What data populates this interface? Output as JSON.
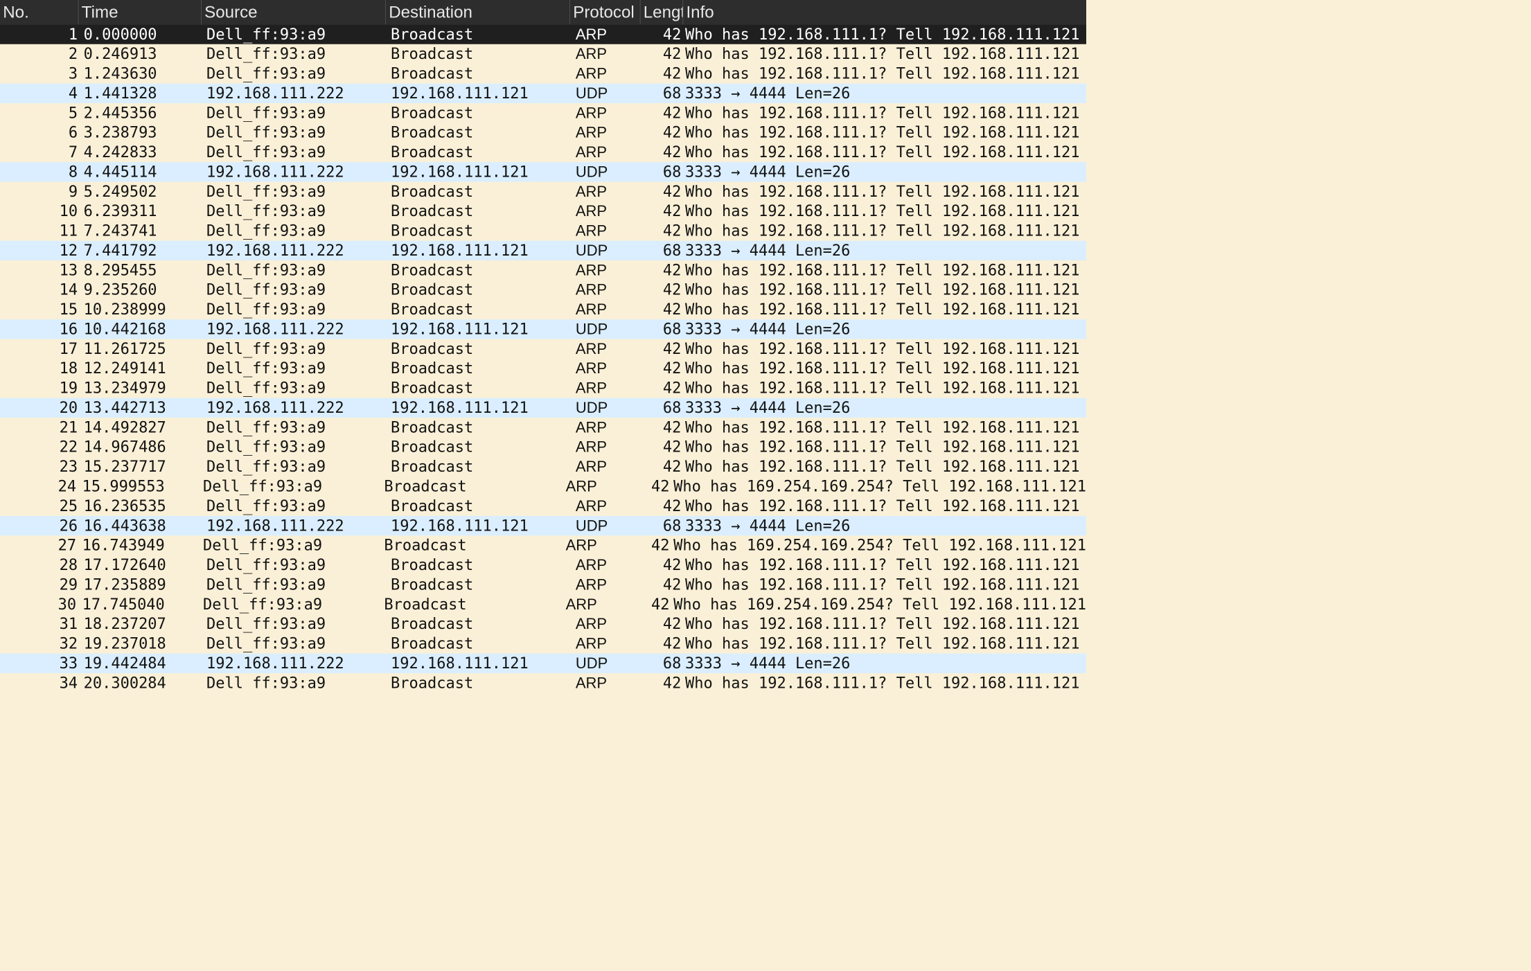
{
  "columns": {
    "no": "No.",
    "time": "Time",
    "source": "Source",
    "destination": "Destination",
    "protocol": "Protocol",
    "length": "Lengt",
    "info": "Info"
  },
  "colors": {
    "arp_row": "#faf0d7",
    "udp_row": "#daeeff",
    "selected_row": "#1f1f1f",
    "header_bg": "#2d2d2d"
  },
  "selected_packet": "1",
  "packets": [
    {
      "no": "1",
      "time": "0.000000",
      "source": "Dell_ff:93:a9",
      "destination": "Broadcast",
      "protocol": "ARP",
      "length": "42",
      "info": "Who has 192.168.111.1? Tell 192.168.111.121"
    },
    {
      "no": "2",
      "time": "0.246913",
      "source": "Dell_ff:93:a9",
      "destination": "Broadcast",
      "protocol": "ARP",
      "length": "42",
      "info": "Who has 192.168.111.1? Tell 192.168.111.121"
    },
    {
      "no": "3",
      "time": "1.243630",
      "source": "Dell_ff:93:a9",
      "destination": "Broadcast",
      "protocol": "ARP",
      "length": "42",
      "info": "Who has 192.168.111.1? Tell 192.168.111.121"
    },
    {
      "no": "4",
      "time": "1.441328",
      "source": "192.168.111.222",
      "destination": "192.168.111.121",
      "protocol": "UDP",
      "length": "68",
      "info": "3333 → 4444 Len=26"
    },
    {
      "no": "5",
      "time": "2.445356",
      "source": "Dell_ff:93:a9",
      "destination": "Broadcast",
      "protocol": "ARP",
      "length": "42",
      "info": "Who has 192.168.111.1? Tell 192.168.111.121"
    },
    {
      "no": "6",
      "time": "3.238793",
      "source": "Dell_ff:93:a9",
      "destination": "Broadcast",
      "protocol": "ARP",
      "length": "42",
      "info": "Who has 192.168.111.1? Tell 192.168.111.121"
    },
    {
      "no": "7",
      "time": "4.242833",
      "source": "Dell_ff:93:a9",
      "destination": "Broadcast",
      "protocol": "ARP",
      "length": "42",
      "info": "Who has 192.168.111.1? Tell 192.168.111.121"
    },
    {
      "no": "8",
      "time": "4.445114",
      "source": "192.168.111.222",
      "destination": "192.168.111.121",
      "protocol": "UDP",
      "length": "68",
      "info": "3333 → 4444 Len=26"
    },
    {
      "no": "9",
      "time": "5.249502",
      "source": "Dell_ff:93:a9",
      "destination": "Broadcast",
      "protocol": "ARP",
      "length": "42",
      "info": "Who has 192.168.111.1? Tell 192.168.111.121"
    },
    {
      "no": "10",
      "time": "6.239311",
      "source": "Dell_ff:93:a9",
      "destination": "Broadcast",
      "protocol": "ARP",
      "length": "42",
      "info": "Who has 192.168.111.1? Tell 192.168.111.121"
    },
    {
      "no": "11",
      "time": "7.243741",
      "source": "Dell_ff:93:a9",
      "destination": "Broadcast",
      "protocol": "ARP",
      "length": "42",
      "info": "Who has 192.168.111.1? Tell 192.168.111.121"
    },
    {
      "no": "12",
      "time": "7.441792",
      "source": "192.168.111.222",
      "destination": "192.168.111.121",
      "protocol": "UDP",
      "length": "68",
      "info": "3333 → 4444 Len=26"
    },
    {
      "no": "13",
      "time": "8.295455",
      "source": "Dell_ff:93:a9",
      "destination": "Broadcast",
      "protocol": "ARP",
      "length": "42",
      "info": "Who has 192.168.111.1? Tell 192.168.111.121"
    },
    {
      "no": "14",
      "time": "9.235260",
      "source": "Dell_ff:93:a9",
      "destination": "Broadcast",
      "protocol": "ARP",
      "length": "42",
      "info": "Who has 192.168.111.1? Tell 192.168.111.121"
    },
    {
      "no": "15",
      "time": "10.238999",
      "source": "Dell_ff:93:a9",
      "destination": "Broadcast",
      "protocol": "ARP",
      "length": "42",
      "info": "Who has 192.168.111.1? Tell 192.168.111.121"
    },
    {
      "no": "16",
      "time": "10.442168",
      "source": "192.168.111.222",
      "destination": "192.168.111.121",
      "protocol": "UDP",
      "length": "68",
      "info": "3333 → 4444 Len=26"
    },
    {
      "no": "17",
      "time": "11.261725",
      "source": "Dell_ff:93:a9",
      "destination": "Broadcast",
      "protocol": "ARP",
      "length": "42",
      "info": "Who has 192.168.111.1? Tell 192.168.111.121"
    },
    {
      "no": "18",
      "time": "12.249141",
      "source": "Dell_ff:93:a9",
      "destination": "Broadcast",
      "protocol": "ARP",
      "length": "42",
      "info": "Who has 192.168.111.1? Tell 192.168.111.121"
    },
    {
      "no": "19",
      "time": "13.234979",
      "source": "Dell_ff:93:a9",
      "destination": "Broadcast",
      "protocol": "ARP",
      "length": "42",
      "info": "Who has 192.168.111.1? Tell 192.168.111.121"
    },
    {
      "no": "20",
      "time": "13.442713",
      "source": "192.168.111.222",
      "destination": "192.168.111.121",
      "protocol": "UDP",
      "length": "68",
      "info": "3333 → 4444 Len=26"
    },
    {
      "no": "21",
      "time": "14.492827",
      "source": "Dell_ff:93:a9",
      "destination": "Broadcast",
      "protocol": "ARP",
      "length": "42",
      "info": "Who has 192.168.111.1? Tell 192.168.111.121"
    },
    {
      "no": "22",
      "time": "14.967486",
      "source": "Dell_ff:93:a9",
      "destination": "Broadcast",
      "protocol": "ARP",
      "length": "42",
      "info": "Who has 192.168.111.1? Tell 192.168.111.121"
    },
    {
      "no": "23",
      "time": "15.237717",
      "source": "Dell_ff:93:a9",
      "destination": "Broadcast",
      "protocol": "ARP",
      "length": "42",
      "info": "Who has 192.168.111.1? Tell 192.168.111.121"
    },
    {
      "no": "24",
      "time": "15.999553",
      "source": "Dell_ff:93:a9",
      "destination": "Broadcast",
      "protocol": "ARP",
      "length": "42",
      "info": "Who has 169.254.169.254? Tell 192.168.111.121"
    },
    {
      "no": "25",
      "time": "16.236535",
      "source": "Dell_ff:93:a9",
      "destination": "Broadcast",
      "protocol": "ARP",
      "length": "42",
      "info": "Who has 192.168.111.1? Tell 192.168.111.121"
    },
    {
      "no": "26",
      "time": "16.443638",
      "source": "192.168.111.222",
      "destination": "192.168.111.121",
      "protocol": "UDP",
      "length": "68",
      "info": "3333 → 4444 Len=26"
    },
    {
      "no": "27",
      "time": "16.743949",
      "source": "Dell_ff:93:a9",
      "destination": "Broadcast",
      "protocol": "ARP",
      "length": "42",
      "info": "Who has 169.254.169.254? Tell 192.168.111.121"
    },
    {
      "no": "28",
      "time": "17.172640",
      "source": "Dell_ff:93:a9",
      "destination": "Broadcast",
      "protocol": "ARP",
      "length": "42",
      "info": "Who has 192.168.111.1? Tell 192.168.111.121"
    },
    {
      "no": "29",
      "time": "17.235889",
      "source": "Dell_ff:93:a9",
      "destination": "Broadcast",
      "protocol": "ARP",
      "length": "42",
      "info": "Who has 192.168.111.1? Tell 192.168.111.121"
    },
    {
      "no": "30",
      "time": "17.745040",
      "source": "Dell_ff:93:a9",
      "destination": "Broadcast",
      "protocol": "ARP",
      "length": "42",
      "info": "Who has 169.254.169.254? Tell 192.168.111.121"
    },
    {
      "no": "31",
      "time": "18.237207",
      "source": "Dell_ff:93:a9",
      "destination": "Broadcast",
      "protocol": "ARP",
      "length": "42",
      "info": "Who has 192.168.111.1? Tell 192.168.111.121"
    },
    {
      "no": "32",
      "time": "19.237018",
      "source": "Dell_ff:93:a9",
      "destination": "Broadcast",
      "protocol": "ARP",
      "length": "42",
      "info": "Who has 192.168.111.1? Tell 192.168.111.121"
    },
    {
      "no": "33",
      "time": "19.442484",
      "source": "192.168.111.222",
      "destination": "192.168.111.121",
      "protocol": "UDP",
      "length": "68",
      "info": "3333 → 4444 Len=26"
    },
    {
      "no": "34",
      "time": "20.300284",
      "source": "Dell_ff:93:a9",
      "destination": "Broadcast",
      "protocol": "ARP",
      "length": "42",
      "info": "Who has 192.168.111.1? Tell 192.168.111.121"
    }
  ]
}
